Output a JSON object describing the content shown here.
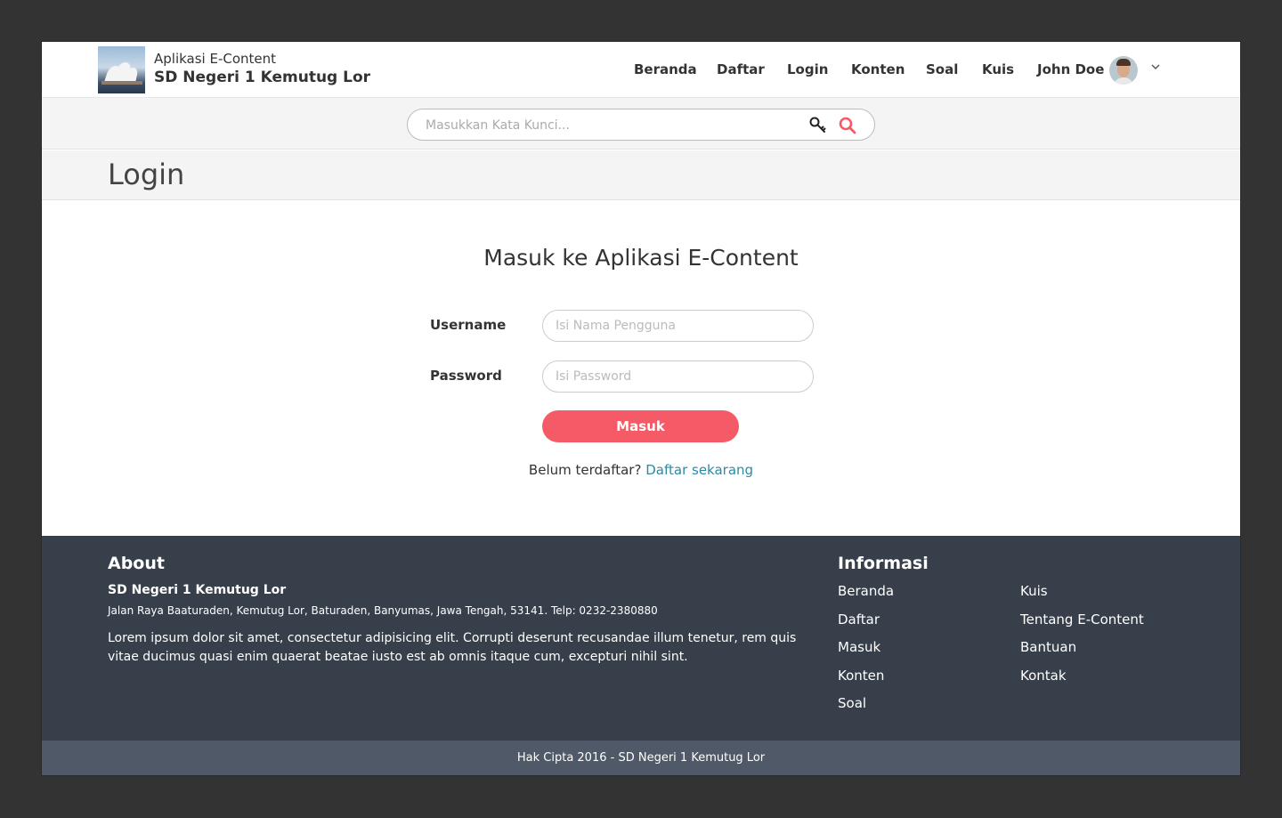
{
  "header": {
    "app_name": "Aplikasi E-Content",
    "school_name": "SD Negeri 1 Kemutug Lor",
    "nav": [
      "Beranda",
      "Daftar",
      "Login",
      "Konten",
      "Soal",
      "Kuis"
    ],
    "user_name": "John Doe"
  },
  "search": {
    "placeholder": "Masukkan Kata Kunci..."
  },
  "page": {
    "title": "Login"
  },
  "login": {
    "heading": "Masuk ke Aplikasi E-Content",
    "username_label": "Username",
    "username_placeholder": "Isi Nama Pengguna",
    "password_label": "Password",
    "password_placeholder": "Isi Password",
    "submit_label": "Masuk",
    "register_prompt": "Belum terdaftar?",
    "register_link": "Daftar sekarang"
  },
  "footer": {
    "about_heading": "About",
    "school_name": "SD Negeri 1 Kemutug Lor",
    "address": "Jalan Raya Baaturaden, Kemutug Lor, Baturaden, Banyumas, Jawa Tengah, 53141. Telp: 0232-2380880",
    "description": "Lorem ipsum dolor sit amet, consectetur adipisicing elit. Corrupti deserunt recusandae illum tenetur, rem quis vitae ducimus quasi enim quaerat beatae iusto est ab omnis itaque cum, excepturi nihil sint.",
    "info_heading": "Informasi",
    "info_links_col1": [
      "Beranda",
      "Daftar",
      "Masuk",
      "Konten",
      "Soal"
    ],
    "info_links_col2": [
      "Kuis",
      "Tentang E-Content",
      "Bantuan",
      "Kontak"
    ],
    "copyright": "Hak Cipta 2016 - SD Negeri 1 Kemutug Lor"
  },
  "colors": {
    "accent": "#f45b66",
    "link": "#2c8aa3",
    "footer_bg": "#373f4a",
    "footer_bottom_bg": "#4f5967"
  },
  "icons": [
    "school-logo",
    "avatar",
    "chevron-down-icon",
    "key-icon",
    "search-icon"
  ]
}
